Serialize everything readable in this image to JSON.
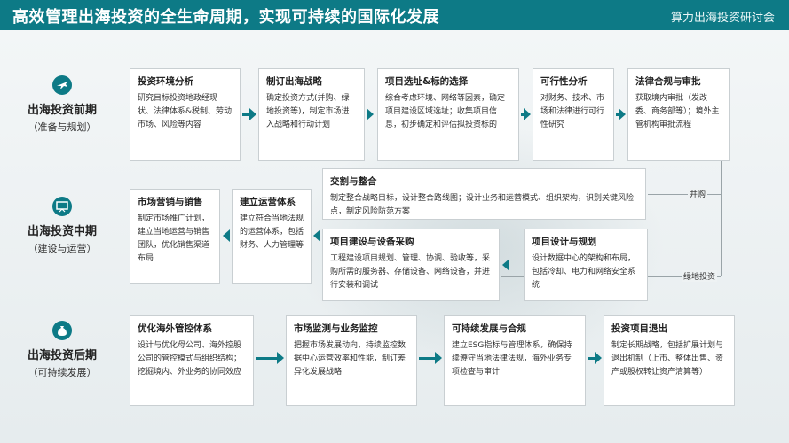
{
  "header": {
    "title": "高效管理出海投资的全生命周期，实现可持续的国际化发展",
    "subtitle": "算力出海投资研讨会"
  },
  "stages": [
    {
      "name": "出海投资前期",
      "sub": "（准备与规划）",
      "icon": "airplane-icon"
    },
    {
      "name": "出海投资中期",
      "sub": "（建设与运营）",
      "icon": "presentation-board-icon"
    },
    {
      "name": "出海投资后期",
      "sub": "（可持续发展）",
      "icon": "money-bag-icon"
    }
  ],
  "pre": [
    {
      "title": "投资环境分析",
      "body": "研究目标投资地政经现状、法律体系&税制、劳动市场、风险等内容"
    },
    {
      "title": "制订出海战略",
      "body": "确定投资方式(并购、绿地投资等)，制定市场进入战略和行动计划"
    },
    {
      "title": "项目选址&标的选择",
      "body": "综合考虑环境、网络等因素，确定项目建设区域选址；收集项目信息，初步确定和评估拟投资标的"
    },
    {
      "title": "可行性分析",
      "body": "对财务、技术、市场和法律进行可行性研究"
    },
    {
      "title": "法律合规与审批",
      "body": "获取境内审批（发改委、商务部等）；境外主管机构审批流程"
    }
  ],
  "mid": {
    "market": {
      "title": "市场营销与销售",
      "body": "制定市场推广计划，建立当地运营与销售团队，优化销售渠道布局"
    },
    "ops": {
      "title": "建立运营体系",
      "body": "建立符合当地法规的运营体系，包括财务、人力管理等"
    },
    "merge": {
      "title": "交割与整合",
      "body": "制定整合战略目标，设计整合路线图；设计业务和运营模式、组织架构，识别关键风险点，制定风险防范方案"
    },
    "build": {
      "title": "项目建设与设备采购",
      "body": "工程建设项目规划、管理、协调、验收等，采购所需的服务器、存储设备、网络设备，并进行安装和调试"
    },
    "design": {
      "title": "项目设计与规划",
      "body": "设计数据中心的架构和布局，包括冷却、电力和网络安全系统"
    },
    "label_merge": "并购",
    "label_greenfield": "绿地投资"
  },
  "post": [
    {
      "title": "优化海外管控体系",
      "body": "设计与优化母公司、海外控股公司的管控模式与组织结构；挖掘境内、外业务的协同效应"
    },
    {
      "title": "市场监测与业务监控",
      "body": "把握市场发展动向，持续监控数据中心运营效率和性能，制订差异化发展战略"
    },
    {
      "title": "可持续发展与合规",
      "body": "建立ESG指标与管理体系，确保持续遵守当地法律法规，海外业务专项检查与审计"
    },
    {
      "title": "投资项目退出",
      "body": "制定长期战略，包括扩展计划与退出机制（上市、整体出售、资产或股权转让资产清算等）"
    }
  ],
  "colors": {
    "accent": "#0d7a86",
    "arrow": "#0d7a86",
    "border": "#c9cfd2"
  }
}
